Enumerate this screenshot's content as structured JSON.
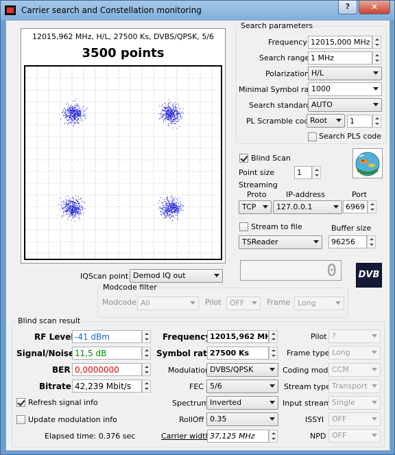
{
  "window": {
    "title": "Carrier search and Constellation monitoring",
    "help_label": "?",
    "close_label": "✕"
  },
  "plot": {
    "info": "12015,962 MHz, H/L, 27500 Ks, DVBS/QPSK, 5/6",
    "points_label": "3500 points",
    "grid_color": "#8a8a8a",
    "point_color": "#1a1ad8"
  },
  "search": {
    "group_title": "Search parameters",
    "frequency_label": "Frequency",
    "frequency_value": "12015,000 MHz",
    "range_label": "Search range",
    "range_value": "1 MHz",
    "polarization_label": "Polarization",
    "polarization_value": "H/L",
    "symrate_label": "Minimal Symbol rate",
    "symrate_value": "1000",
    "standard_label": "Search standard",
    "standard_value": "AUTO",
    "pls_label": "PL Scramble code",
    "pls_mode": "Root",
    "pls_value": "1",
    "search_pls_label": "Search PLS code"
  },
  "blind": {
    "blind_scan_label": "Blind Scan",
    "point_size_label": "Point size",
    "point_size_value": "1",
    "streaming_label": "Streaming",
    "proto_label": "Proto",
    "proto_value": "TCP",
    "ip_label": "IP-address",
    "ip_value": "127.0.0.1",
    "port_label": "Port",
    "port_value": "6969",
    "stream_to_file_label": "Stream to file",
    "buffer_label": "Buffer size",
    "reader_value": "TSReader",
    "buffer_value": "96256"
  },
  "iq": {
    "label": "IQScan point",
    "value": "Demod IQ out",
    "modcode_title": "Modcode filter",
    "modcode_label": "Modcode",
    "modcode_value": "All",
    "pilot_label": "Pilot",
    "pilot_value": "OFF",
    "frame_label": "Frame",
    "frame_value": "Long",
    "lcd_value": "0"
  },
  "result": {
    "group_title": "Blind scan result",
    "rf_label": "RF Level",
    "rf_value": "-41 dBm",
    "rf_color": "#1a5fe0",
    "sn_label": "Signal/Noise",
    "sn_value": "11,5 dB",
    "sn_color": "#008800",
    "ber_label": "BER",
    "ber_value": "0,0000000",
    "ber_color": "#e00000",
    "bitrate_label": "Bitrate",
    "bitrate_value": "42,239 Mbit/s",
    "refresh_label": "Refresh signal info",
    "update_label": "Update modulation info",
    "elapsed_label": "Elapsed time: 0.376 sec",
    "frequency_label": "Frequency",
    "frequency_value": "12015,962 MHz",
    "symrate_label": "Symbol rate",
    "symrate_value": "27500 Ks",
    "modulation_label": "Modulation",
    "modulation_value": "DVBS/QPSK",
    "fec_label": "FEC",
    "fec_value": "5/6",
    "spectrum_label": "Spectrum",
    "spectrum_value": "Inverted",
    "rolloff_label": "RollOff",
    "rolloff_value": "0.35",
    "carrier_label": "Carrier width",
    "carrier_value": "37,125 MHz",
    "pilot_label": "Pilot",
    "pilot_value": "?",
    "frametype_label": "Frame type",
    "frametype_value": "Long",
    "coding_label": "Coding mode",
    "coding_value": "CCM",
    "streamtype_label": "Stream type",
    "streamtype_value": "Transport",
    "inputstream_label": "Input stream",
    "inputstream_value": "Single",
    "issyi_label": "ISSYI",
    "issyi_value": "OFF",
    "npd_label": "NPD",
    "npd_value": "OFF"
  },
  "dvb_logo_text": "DVB"
}
